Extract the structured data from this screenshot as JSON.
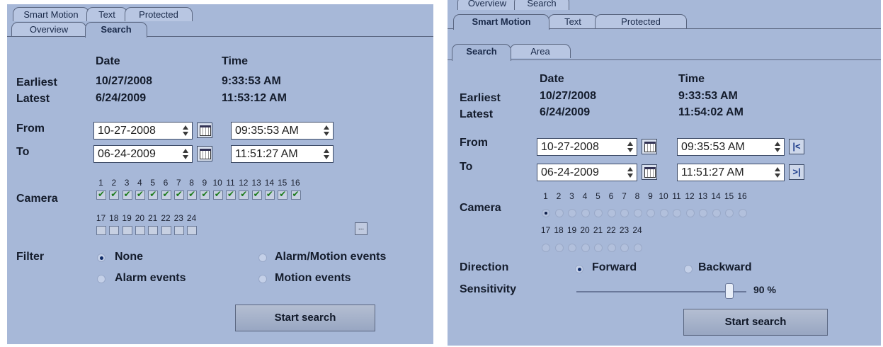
{
  "left": {
    "tabs_row1": [
      "Smart Motion",
      "Text",
      "Protected"
    ],
    "tabs_row2": [
      "Overview",
      "Search"
    ],
    "active_tab": "Search",
    "header_date": "Date",
    "header_time": "Time",
    "earliest_label": "Earliest",
    "earliest_date": "10/27/2008",
    "earliest_time": "9:33:53 AM",
    "latest_label": "Latest",
    "latest_date": "6/24/2009",
    "latest_time": "11:53:12 AM",
    "from_label": "From",
    "from_date": "10-27-2008",
    "from_time": "09:35:53 AM",
    "to_label": "To",
    "to_date": "06-24-2009",
    "to_time": "11:51:27 AM",
    "camera_label": "Camera",
    "cameras_row1": [
      "1",
      "2",
      "3",
      "4",
      "5",
      "6",
      "7",
      "8",
      "9",
      "10",
      "11",
      "12",
      "13",
      "14",
      "15",
      "16"
    ],
    "cameras_row2": [
      "17",
      "18",
      "19",
      "20",
      "21",
      "22",
      "23",
      "24"
    ],
    "cameras_checked_row1": [
      true,
      true,
      true,
      true,
      true,
      true,
      true,
      true,
      true,
      true,
      true,
      true,
      true,
      true,
      true,
      true
    ],
    "cameras_checked_row2": [
      false,
      false,
      false,
      false,
      false,
      false,
      false,
      false
    ],
    "more_button": "...",
    "filter_label": "Filter",
    "filter_options": [
      "None",
      "Alarm/Motion events",
      "Alarm events",
      "Motion events"
    ],
    "filter_selected": "None",
    "start_button": "Start search"
  },
  "right": {
    "tabs_row0": [
      "Overview",
      "Search"
    ],
    "tabs_row1": [
      "Smart Motion",
      "Text",
      "Protected"
    ],
    "tabs_row2": [
      "Search",
      "Area"
    ],
    "active_tab": "Smart Motion",
    "active_subtab": "Search",
    "header_date": "Date",
    "header_time": "Time",
    "earliest_label": "Earliest",
    "earliest_date": "10/27/2008",
    "earliest_time": "9:33:53 AM",
    "latest_label": "Latest",
    "latest_date": "6/24/2009",
    "latest_time": "11:54:02 AM",
    "from_label": "From",
    "from_date": "10-27-2008",
    "from_time": "09:35:53 AM",
    "first_button": "|<",
    "to_label": "To",
    "to_date": "06-24-2009",
    "to_time": "11:51:27 AM",
    "last_button": ">|",
    "camera_label": "Camera",
    "cameras_row1": [
      "1",
      "2",
      "3",
      "4",
      "5",
      "6",
      "7",
      "8",
      "9",
      "10",
      "11",
      "12",
      "13",
      "14",
      "15",
      "16"
    ],
    "cameras_row2": [
      "17",
      "18",
      "19",
      "20",
      "21",
      "22",
      "23",
      "24"
    ],
    "camera_selected": "1",
    "direction_label": "Direction",
    "direction_options": [
      "Forward",
      "Backward"
    ],
    "direction_selected": "Forward",
    "sensitivity_label": "Sensitivity",
    "sensitivity_value": "90 %",
    "sensitivity_level": 0.9,
    "start_button": "Start search"
  },
  "colors": {
    "panel_bg": "#a7b8d8",
    "check_green": "#1a7a1a",
    "text": "#141c2c"
  }
}
